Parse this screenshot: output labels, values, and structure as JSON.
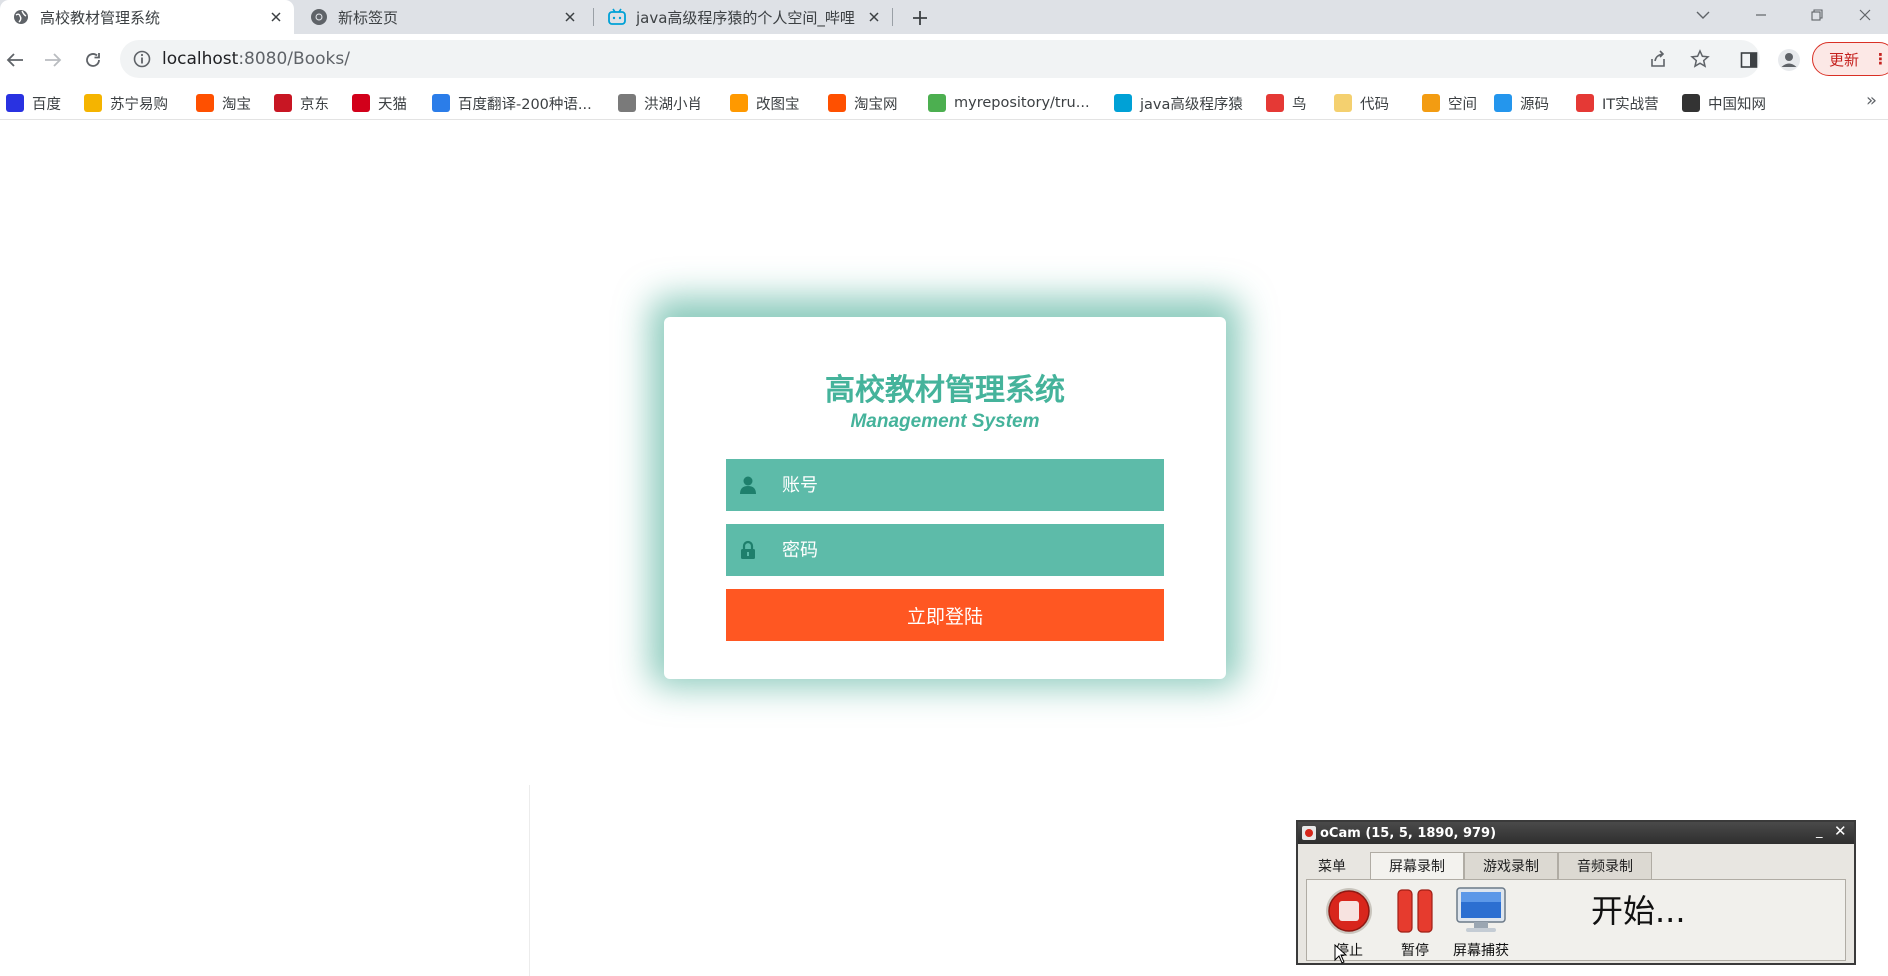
{
  "browser": {
    "tabs": [
      {
        "title": "高校教材管理系统",
        "active": true
      },
      {
        "title": "新标签页",
        "active": false
      },
      {
        "title": "java高级程序猿的个人空间_哔哩",
        "active": false
      }
    ],
    "url_host": "localhost",
    "url_rest": ":8080/Books/",
    "update_label": "更新",
    "bookmarks": [
      {
        "label": "百度",
        "icon": "baidu-icon",
        "color": "#2932e1"
      },
      {
        "label": "苏宁易购",
        "icon": "suning-icon",
        "color": "#f5b400"
      },
      {
        "label": "淘宝",
        "icon": "taobao-icon",
        "color": "#ff5000"
      },
      {
        "label": "京东",
        "icon": "jd-icon",
        "color": "#c81623"
      },
      {
        "label": "天猫",
        "icon": "tmall-icon",
        "color": "#d2001a"
      },
      {
        "label": "百度翻译-200种语...",
        "icon": "translate-icon",
        "color": "#2b7de9"
      },
      {
        "label": "洪湖小肖",
        "icon": "bird-icon",
        "color": "#7a7a7a"
      },
      {
        "label": "改图宝",
        "icon": "gaitubao-icon",
        "color": "#ff9900"
      },
      {
        "label": "淘宝网",
        "icon": "taobao-icon",
        "color": "#ff5000"
      },
      {
        "label": "myrepository/tru...",
        "icon": "repo-icon",
        "color": "#4caf50"
      },
      {
        "label": "java高级程序猿",
        "icon": "bilibili-icon",
        "color": "#00a1d6"
      },
      {
        "label": "鸟",
        "icon": "bird-red-icon",
        "color": "#e53935"
      },
      {
        "label": "代码",
        "icon": "code-icon",
        "color": "#f4d06f"
      },
      {
        "label": "空间",
        "icon": "space-icon",
        "color": "#f39c12"
      },
      {
        "label": "源码",
        "icon": "docker-icon",
        "color": "#2496ed"
      },
      {
        "label": "IT实战营",
        "icon": "chrome-red-icon",
        "color": "#e53935"
      },
      {
        "label": "中国知网",
        "icon": "cnki-icon",
        "color": "#333333"
      }
    ]
  },
  "login": {
    "title": "高校教材管理系统",
    "subtitle": "Management System",
    "account_placeholder": "账号",
    "password_placeholder": "密码",
    "login_button": "立即登陆",
    "accent": "#45b39b",
    "field_color": "#5dbba9",
    "button_color": "#ff5722"
  },
  "ocam": {
    "title": "oCam (15, 5, 1890, 979)",
    "tabs": [
      "菜单",
      "屏幕录制",
      "游戏录制",
      "音频录制"
    ],
    "active_tab": "屏幕录制",
    "tools": [
      "停止",
      "暂停",
      "屏幕捕获"
    ],
    "status": "开始..."
  }
}
